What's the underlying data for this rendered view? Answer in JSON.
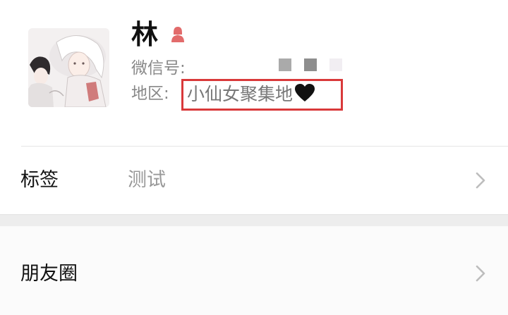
{
  "profile": {
    "name": "林",
    "gender_icon": "female-user-icon",
    "wechat_id_label": "微信号:",
    "region_label": "地区:",
    "region_value": "小仙女聚集地",
    "region_emoji_icon": "black-heart-icon",
    "highlight_color": "#d9393a"
  },
  "rows": {
    "tags": {
      "label": "标签",
      "value": "测试"
    },
    "moments": {
      "label": "朋友圈"
    }
  }
}
